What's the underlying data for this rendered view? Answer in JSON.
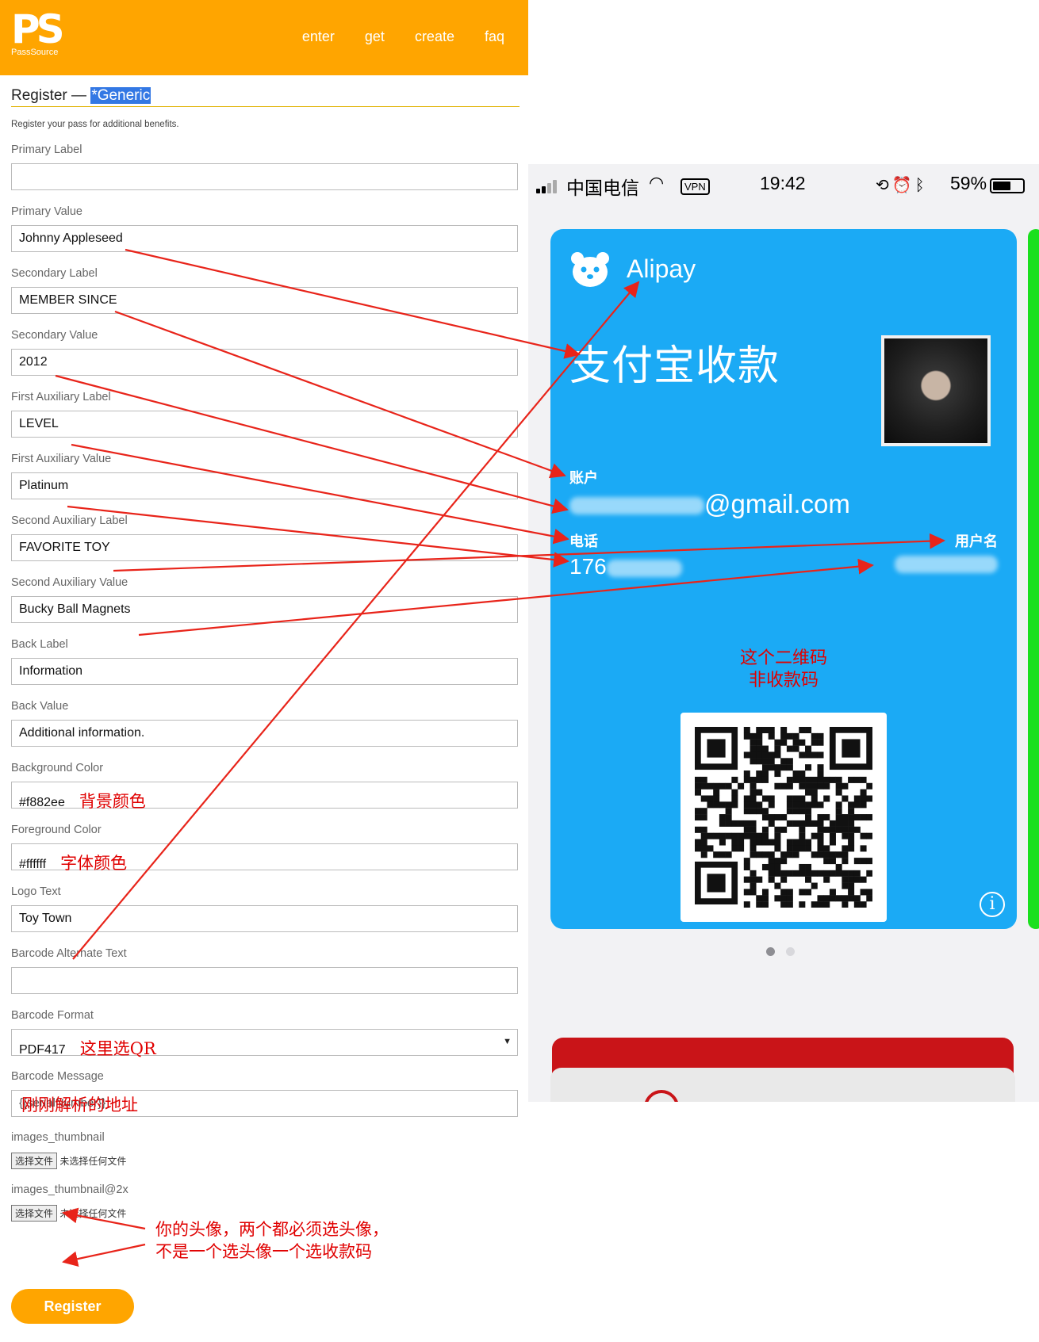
{
  "header": {
    "logo_mark": "PS",
    "logo_name": "PassSource",
    "nav": [
      "enter",
      "get",
      "create",
      "faq"
    ]
  },
  "form": {
    "title_prefix": "Register — ",
    "title_highlight": "*Generic",
    "subtitle": "Register your pass for additional benefits.",
    "fields": [
      {
        "label": "Primary Label",
        "value": ""
      },
      {
        "label": "Primary Value",
        "value": "Johnny Appleseed"
      },
      {
        "label": "Secondary Label",
        "value": "MEMBER SINCE"
      },
      {
        "label": "Secondary Value",
        "value": "2012"
      },
      {
        "label": "First Auxiliary Label",
        "value": "LEVEL"
      },
      {
        "label": "First Auxiliary Value",
        "value": "Platinum"
      },
      {
        "label": "Second Auxiliary Label",
        "value": "FAVORITE TOY"
      },
      {
        "label": "Second Auxiliary Value",
        "value": "Bucky Ball Magnets"
      },
      {
        "label": "Back Label",
        "value": "Information"
      },
      {
        "label": "Back Value",
        "value": "Additional information."
      },
      {
        "label": "Background Color",
        "value": "#f882ee",
        "note": "背景颜色"
      },
      {
        "label": "Foreground Color",
        "value": "#ffffff",
        "note": "字体颜色"
      },
      {
        "label": "Logo Text",
        "value": "Toy Town"
      },
      {
        "label": "Barcode Alternate Text",
        "value": ""
      },
      {
        "label": "Barcode Format",
        "value": "PDF417",
        "note": "这里选QR"
      },
      {
        "label": "Barcode Message",
        "value": "{{serialNumber}}",
        "note": "刚刚解析的地址"
      }
    ],
    "files": [
      {
        "label": "images_thumbnail",
        "button": "选择文件",
        "status": "未选择任何文件"
      },
      {
        "label": "images_thumbnail@2x",
        "button": "选择文件",
        "status": "未选择任何文件"
      }
    ],
    "avatar_note_line1": "你的头像，两个都必须选头像，",
    "avatar_note_line2": "不是一个选头像一个选收款码",
    "submit_label": "Register"
  },
  "phone": {
    "status": {
      "carrier": "中国电信",
      "vpn": "VPN",
      "time": "19:42",
      "battery": "59%",
      "battery_level": 0.59
    },
    "pass": {
      "logo_text": "Alipay",
      "primary_value": "支付宝收款",
      "secondary_label": "账户",
      "secondary_value_suffix": "@gmail.com",
      "aux1_label": "电话",
      "aux1_value": "176",
      "aux2_label": "用户名",
      "qr_note_line1": "这个二维码",
      "qr_note_line2": "非收款码",
      "info_icon": "i",
      "background_color": "#1baaf5"
    }
  },
  "colors": {
    "brand": "#ffa500",
    "annotation": "#e00000"
  }
}
